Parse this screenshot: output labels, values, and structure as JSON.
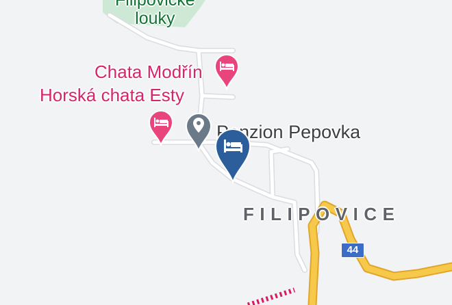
{
  "map": {
    "colors": {
      "land": "#f1f3f4",
      "park": "#cde9d6",
      "road_minor": "#ffffff",
      "road_main": "#f6c94a",
      "road_main_edge": "#e0a52a",
      "rail": "#d81b60",
      "hotel_pin": "#e8457d",
      "selected_pin": "#2c5e9c",
      "poi_pin": "#6b7a88"
    },
    "park_label": {
      "line1": "Filipovické",
      "line2": "louky"
    },
    "hotels": [
      {
        "name": "Chata Modřín",
        "icon": "bed-icon"
      },
      {
        "name": "Horská chata Esty",
        "icon": "bed-icon"
      }
    ],
    "poi": {
      "name": "Penzion Pepovka",
      "icon": "place-icon"
    },
    "selected": {
      "icon": "bed-icon"
    },
    "town": "FILIPOVICE",
    "route_shield": "44"
  }
}
